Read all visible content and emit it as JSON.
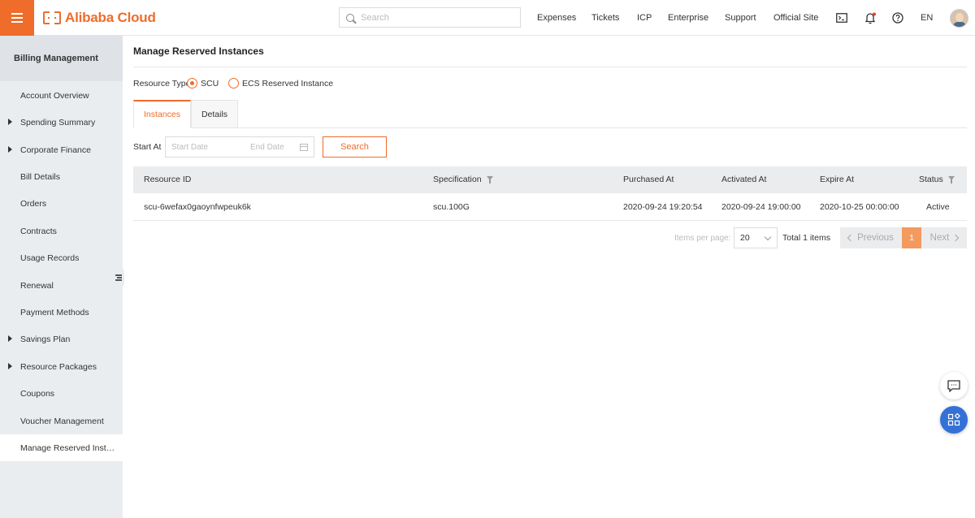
{
  "header": {
    "brand": "Alibaba Cloud",
    "search_placeholder": "Search",
    "nav": [
      "Expenses",
      "Tickets",
      "ICP",
      "Enterprise",
      "Support",
      "Official Site"
    ],
    "language": "EN",
    "icons": [
      "menu-icon",
      "search-icon",
      "terminal-icon",
      "bell-icon",
      "help-icon"
    ],
    "accent_color": "#ef6c2a"
  },
  "sidebar": {
    "title": "Billing Management",
    "items": [
      {
        "label": "Account Overview",
        "expandable": false
      },
      {
        "label": "Spending Summary",
        "expandable": true
      },
      {
        "label": "Corporate Finance",
        "expandable": true
      },
      {
        "label": "Bill Details",
        "expandable": false
      },
      {
        "label": "Orders",
        "expandable": false
      },
      {
        "label": "Contracts",
        "expandable": false
      },
      {
        "label": "Usage Records",
        "expandable": false
      },
      {
        "label": "Renewal",
        "expandable": false
      },
      {
        "label": "Payment Methods",
        "expandable": false
      },
      {
        "label": "Savings Plan",
        "expandable": true
      },
      {
        "label": "Resource Packages",
        "expandable": true
      },
      {
        "label": "Coupons",
        "expandable": false
      },
      {
        "label": "Voucher Management",
        "expandable": false
      },
      {
        "label": "Manage Reserved Inst…",
        "expandable": false,
        "active": true
      }
    ]
  },
  "main": {
    "title": "Manage Reserved Instances",
    "resource_type_label": "Resource Type",
    "resource_types": [
      {
        "label": "SCU",
        "checked": true
      },
      {
        "label": "ECS Reserved Instance",
        "checked": false
      }
    ],
    "tabs": [
      {
        "label": "Instances",
        "active": true
      },
      {
        "label": "Details",
        "active": false
      }
    ],
    "filter": {
      "start_at_label": "Start At",
      "start_placeholder": "Start Date",
      "end_placeholder": "End Date",
      "search_label": "Search"
    },
    "table": {
      "columns": [
        "Resource ID",
        "Specification",
        "Purchased At",
        "Activated At",
        "Expire At",
        "Status"
      ],
      "rows": [
        [
          "scu-6wefax0gaoynfwpeuk6k",
          "scu.100G",
          "2020-09-24 19:20:54",
          "2020-09-24 19:00:00",
          "2020-10-25 00:00:00",
          "Active"
        ]
      ]
    },
    "pagination": {
      "items_per_page_label": "Items per page:",
      "items_per_page": "20",
      "total": "Total 1 items",
      "previous": "Previous",
      "current_page": "1",
      "next": "Next"
    }
  }
}
